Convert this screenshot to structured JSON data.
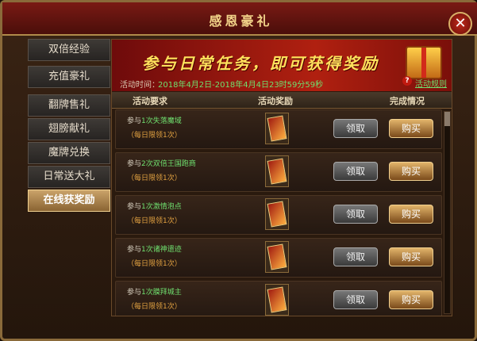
{
  "window": {
    "title": "感恩豪礼",
    "close": "✕"
  },
  "sidebar": {
    "items": [
      {
        "label": "双倍经验"
      },
      {
        "label": "充值豪礼"
      },
      {
        "label": "翻牌售礼"
      },
      {
        "label": "翅膀献礼"
      },
      {
        "label": "魔牌兑换"
      },
      {
        "label": "日常送大礼"
      },
      {
        "label": "在线获奖励",
        "active": true
      }
    ]
  },
  "banner": {
    "headline": "参与日常任务，即可获得奖励",
    "time_label": "活动时间：",
    "time_value": "2018年4月2日-2018年4月4日23时59分59秒",
    "rules_link": "活动规则"
  },
  "table": {
    "headers": {
      "requirement": "活动要求",
      "reward": "活动奖励",
      "status": "完成情况"
    },
    "rows": [
      {
        "prefix": "参与",
        "task": "1次失落魔域",
        "limit": "（每日限领1次）",
        "claim": "领取",
        "buy": "购买"
      },
      {
        "prefix": "参与",
        "task": "2次双倍王国跑商",
        "limit": "（每日限领1次）",
        "claim": "领取",
        "buy": "购买"
      },
      {
        "prefix": "参与",
        "task": "1次激情泡点",
        "limit": "（每日限领1次）",
        "claim": "领取",
        "buy": "购买"
      },
      {
        "prefix": "参与",
        "task": "1次诸神遗迹",
        "limit": "（每日限领1次）",
        "claim": "领取",
        "buy": "购买"
      },
      {
        "prefix": "参与",
        "task": "1次膜拜城主",
        "limit": "（每日限领1次）",
        "claim": "领取",
        "buy": "购买"
      }
    ]
  },
  "colors": {
    "accent": "#ffe15c",
    "task_green": "#6fe06f",
    "limit_orange": "#e0a040"
  },
  "icons": {
    "close": "close-icon",
    "help": "help-icon",
    "gift": "gift-box-icon",
    "reward": "reward-card-icon"
  }
}
